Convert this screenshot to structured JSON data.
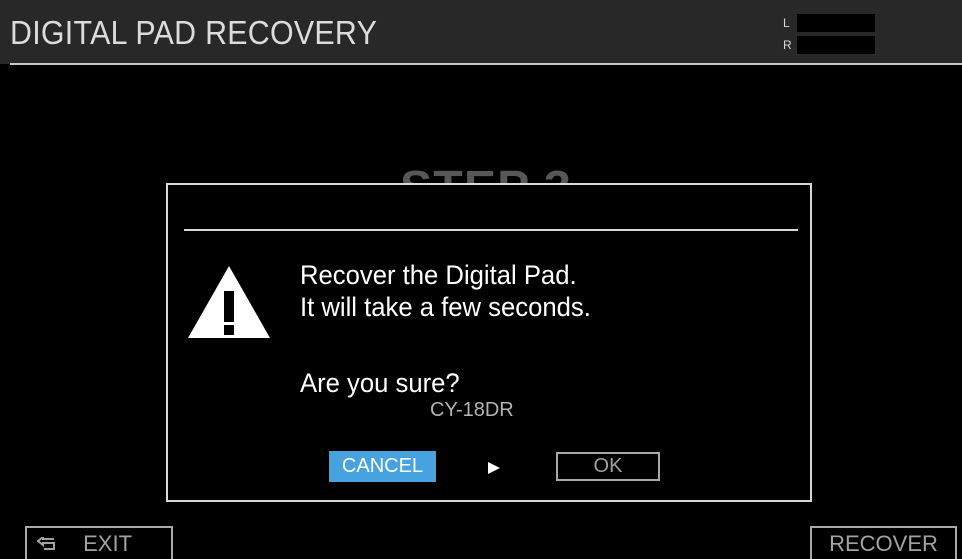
{
  "header": {
    "title": "DIGITAL PAD RECOVERY",
    "meter_left_label": "L",
    "meter_right_label": "R"
  },
  "background": {
    "step_text": "STEP 3"
  },
  "dialog": {
    "line1": "Recover the Digital Pad.",
    "line2": "It will take a few seconds.",
    "question": "Are you sure?",
    "device_name": "CY-18DR",
    "cancel_label": "CANCEL",
    "ok_label": "OK"
  },
  "footer": {
    "exit_label": "EXIT",
    "recover_label": "RECOVER"
  },
  "icons": {
    "warning": "warning-icon",
    "return": "return-icon",
    "cursor": "play-arrow-icon"
  },
  "colors": {
    "accent": "#47a3df",
    "border": "#d8d8d8",
    "muted_text": "#a2a2a2"
  }
}
